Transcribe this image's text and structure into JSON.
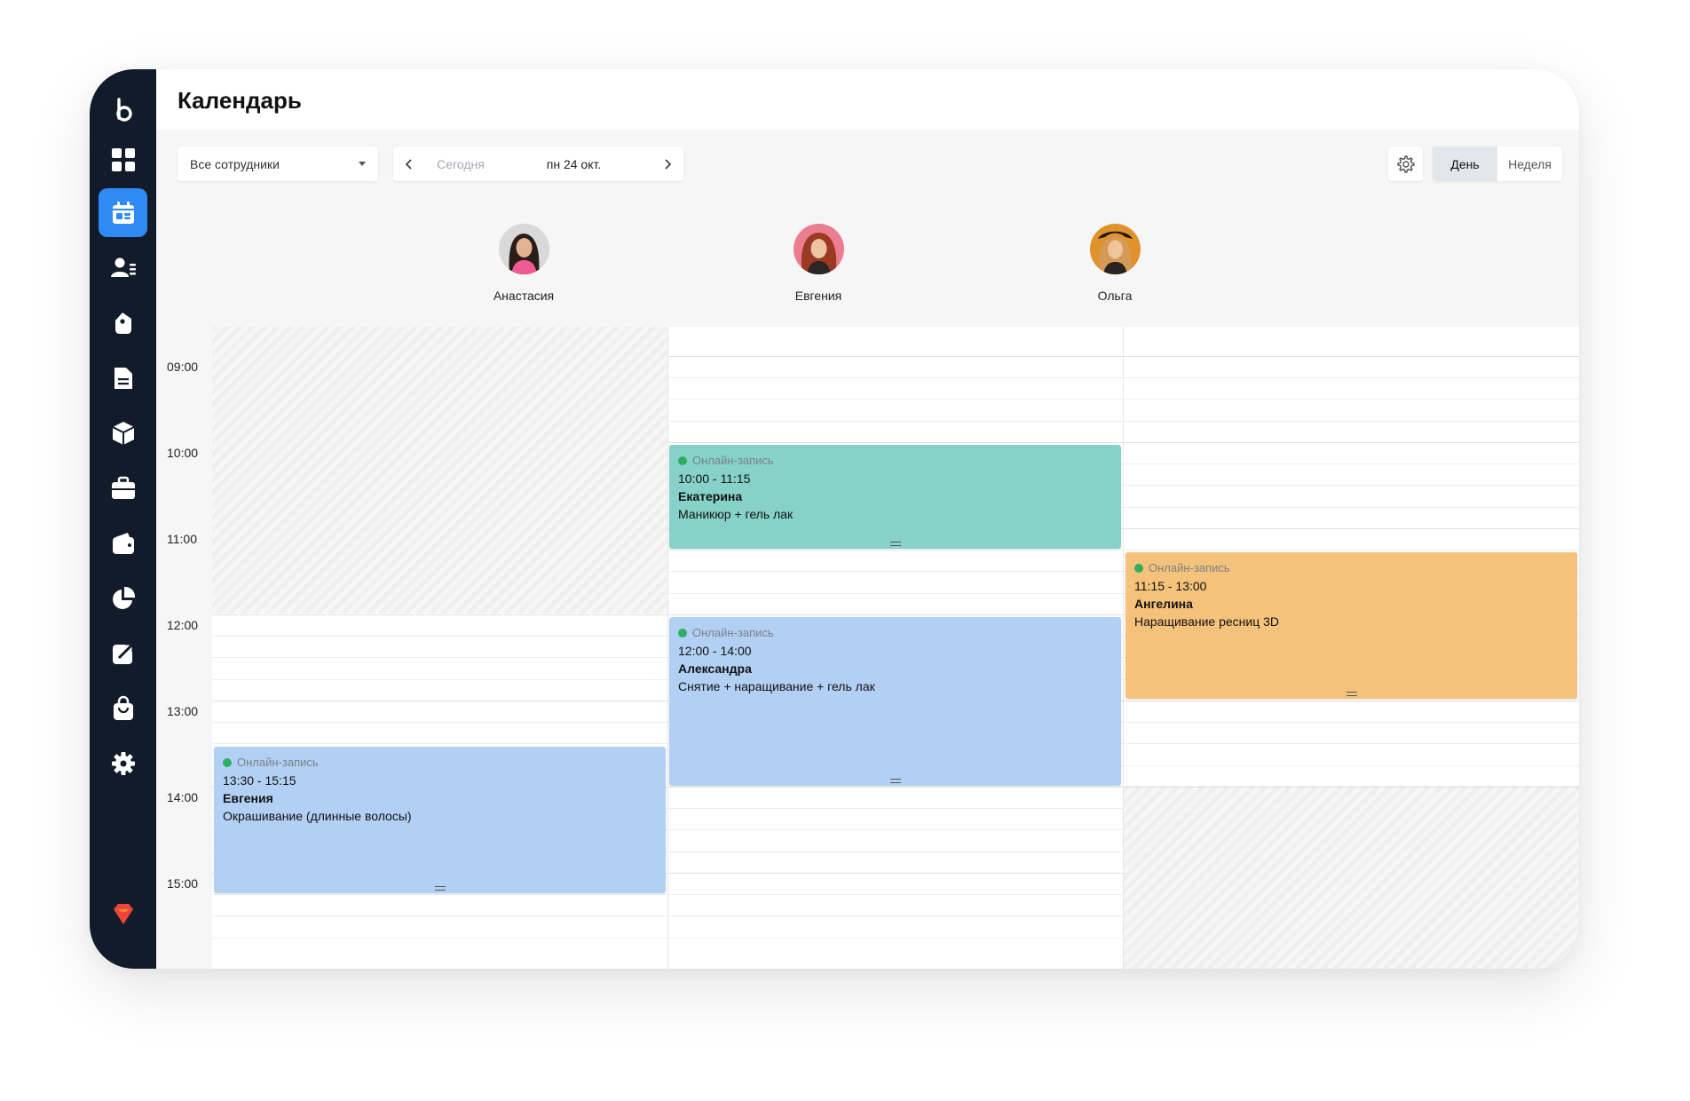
{
  "page": {
    "title": "Календарь"
  },
  "toolbar": {
    "staff_filter": "Все сотрудники",
    "today_label": "Сегодня",
    "date_label": "пн 24 окт.",
    "view_day": "День",
    "view_week": "Неделя",
    "active_view": "День"
  },
  "sidebar": {
    "items": [
      {
        "name": "logo-icon",
        "active": false
      },
      {
        "name": "dashboard-icon",
        "active": false
      },
      {
        "name": "calendar-icon",
        "active": true
      },
      {
        "name": "clients-icon",
        "active": false
      },
      {
        "name": "tag-icon",
        "active": false
      },
      {
        "name": "document-icon",
        "active": false
      },
      {
        "name": "box-icon",
        "active": false
      },
      {
        "name": "briefcase-icon",
        "active": false
      },
      {
        "name": "wallet-icon",
        "active": false
      },
      {
        "name": "pie-chart-icon",
        "active": false
      },
      {
        "name": "external-link-icon",
        "active": false
      },
      {
        "name": "shopping-bag-icon",
        "active": false
      },
      {
        "name": "settings-icon",
        "active": false
      },
      {
        "name": "diamond-icon",
        "active": false
      }
    ],
    "accent_color": "#2f8af5",
    "background_color": "#121b2a"
  },
  "staff": [
    {
      "name": "Анастасия"
    },
    {
      "name": "Евгения"
    },
    {
      "name": "Ольга"
    }
  ],
  "time_labels": [
    "09:00",
    "10:00",
    "11:00",
    "12:00",
    "13:00",
    "14:00",
    "15:00"
  ],
  "events": [
    {
      "staff": "Евгения",
      "source": "Онлайн-запись",
      "time": "10:00 - 11:15",
      "client": "Екатерина",
      "service": "Маникюр + гель лак",
      "color": "#86d2c8"
    },
    {
      "staff": "Евгения",
      "source": "Онлайн-запись",
      "time": "12:00 - 14:00",
      "client": "Александра",
      "service": "Снятие + наращивание + гель лак",
      "color": "#b2d0f4"
    },
    {
      "staff": "Ольга",
      "source": "Онлайн-запись",
      "time": "11:15 - 13:00",
      "client": "Ангелина",
      "service": "Наращивание ресниц 3D",
      "color": "#f4c27a"
    },
    {
      "staff": "Анастасия",
      "source": "Онлайн-запись",
      "time": "13:30 - 15:15",
      "client": "Евгения",
      "service": "Окрашивание (длинные волосы)",
      "color": "#b2d0f4"
    }
  ],
  "colors": {
    "online_dot": "#2fae63"
  }
}
